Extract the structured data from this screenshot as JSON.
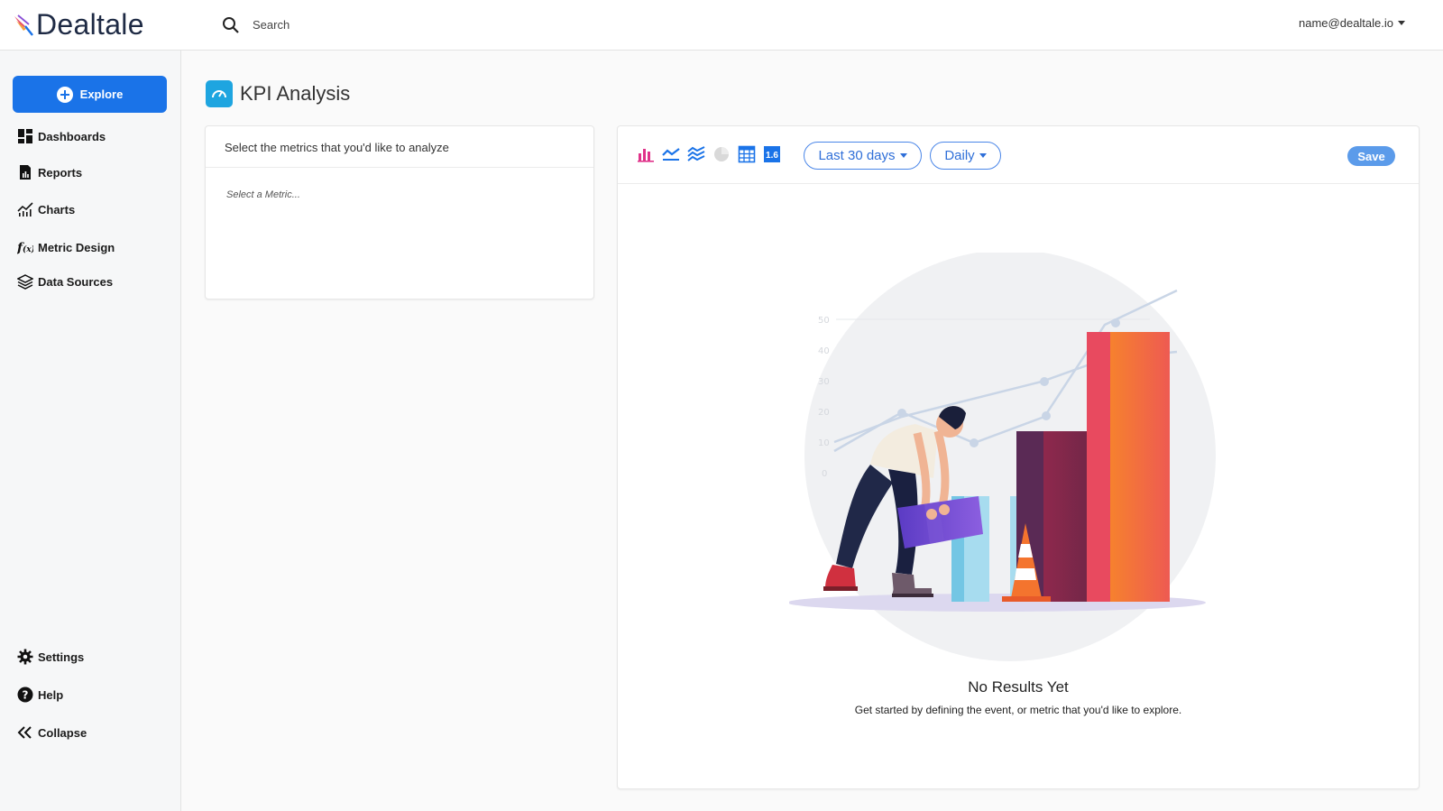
{
  "brand": {
    "name": "Dealtale"
  },
  "search": {
    "placeholder": "Search"
  },
  "user": {
    "email": "name@dealtale.io"
  },
  "sidebar": {
    "explore_label": "Explore",
    "items": [
      {
        "label": "Dashboards",
        "icon": "dashboard-icon"
      },
      {
        "label": "Reports",
        "icon": "report-icon"
      },
      {
        "label": "Charts",
        "icon": "chart-icon"
      },
      {
        "label": "Metric Design",
        "icon": "function-icon"
      },
      {
        "label": "Data Sources",
        "icon": "layers-icon"
      }
    ],
    "bottom_items": [
      {
        "label": "Settings",
        "icon": "gear-icon"
      },
      {
        "label": "Help",
        "icon": "help-icon"
      },
      {
        "label": "Collapse",
        "icon": "collapse-icon"
      }
    ]
  },
  "page": {
    "title": "KPI Analysis"
  },
  "metrics_panel": {
    "header": "Select the metrics that you'd like to analyze",
    "placeholder": "Select a Metric..."
  },
  "results_panel": {
    "date_range": "Last 30 days",
    "granularity": "Daily",
    "save_label": "Save",
    "number_viz_label": "1.6",
    "empty_title": "No Results Yet",
    "empty_description": "Get started by defining the event, or metric that you'd like to explore.",
    "illustration_axis_ticks": [
      "50",
      "40",
      "30",
      "20",
      "10",
      "0"
    ]
  },
  "colors": {
    "primary": "#1a73e8",
    "save": "#5b9bea",
    "kpi_icon": "#1ea5e0"
  }
}
